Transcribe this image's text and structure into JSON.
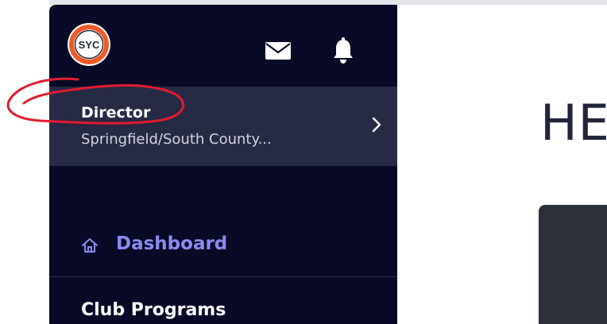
{
  "sidebar": {
    "logo_text": "SYC",
    "mail_icon": "envelope-icon",
    "notifications_icon": "bell-icon",
    "role": {
      "title": "Director",
      "subtitle": "Springfield/South County..."
    },
    "nav": {
      "dashboard_label": "Dashboard",
      "dashboard_icon": "home-icon",
      "section_title": "Club Programs"
    }
  },
  "main": {
    "heading": "HE"
  },
  "colors": {
    "sidebar_bg": "#080a27",
    "role_box_bg": "#262a45",
    "dashboard_accent": "#8b8cf0",
    "annotation_red": "#e11d2f",
    "logo_orange": "#f05a28"
  }
}
